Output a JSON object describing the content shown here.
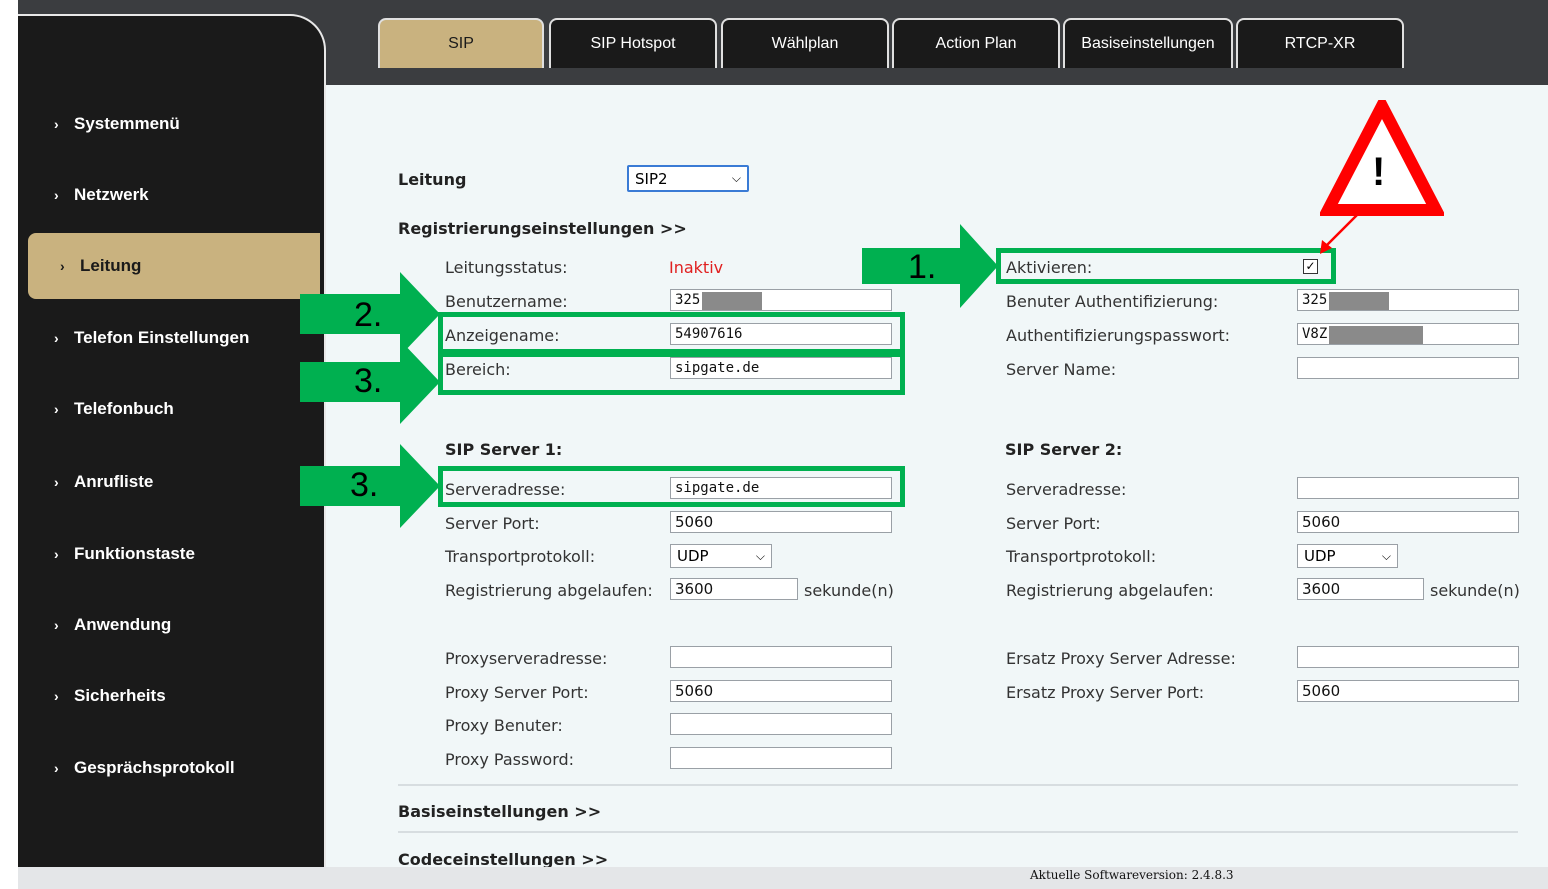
{
  "tabs": [
    "SIP",
    "SIP Hotspot",
    "Wählplan",
    "Action Plan",
    "Basiseinstellungen",
    "RTCP-XR"
  ],
  "sidebar": {
    "items": [
      "Systemmenü",
      "Netzwerk",
      "Leitung",
      "Telefon Einstellungen",
      "Telefonbuch",
      "Anrufliste",
      "Funktionstaste",
      "Anwendung",
      "Sicherheits",
      "Gesprächsprotokoll"
    ],
    "active": "Leitung"
  },
  "line": {
    "label": "Leitung",
    "value": "SIP2"
  },
  "registration": {
    "header": "Registrierungseinstellungen >>",
    "status_label": "Leitungsstatus:",
    "status_value": "Inaktiv",
    "username_label": "Benutzername:",
    "username_value": "325",
    "display_label": "Anzeigename:",
    "display_value": "54907616",
    "realm_label": "Bereich:",
    "realm_value": "sipgate.de",
    "activate_label": "Aktivieren:",
    "activate_checked": true,
    "auth_user_label": "Benuter Authentifizierung:",
    "auth_user_value": "325",
    "auth_pass_label": "Authentifizierungspasswort:",
    "auth_pass_value": "V8Z",
    "server_name_label": "Server Name:",
    "server_name_value": ""
  },
  "server1": {
    "title": "SIP Server 1:",
    "address_label": "Serveradresse:",
    "address_value": "sipgate.de",
    "port_label": "Server Port:",
    "port_value": "5060",
    "transport_label": "Transportprotokoll:",
    "transport_value": "UDP",
    "expire_label": "Registrierung abgelaufen:",
    "expire_value": "3600",
    "unit": "sekunde(n)"
  },
  "server2": {
    "title": "SIP Server 2:",
    "address_label": "Serveradresse:",
    "address_value": "",
    "port_label": "Server Port:",
    "port_value": "5060",
    "transport_label": "Transportprotokoll:",
    "transport_value": "UDP",
    "expire_label": "Registrierung abgelaufen:",
    "expire_value": "3600",
    "unit": "sekunde(n)"
  },
  "proxy": {
    "address_label": "Proxyserveradresse:",
    "address_value": "",
    "port_label": "Proxy Server Port:",
    "port_value": "5060",
    "user_label": "Proxy Benuter:",
    "user_value": "",
    "password_label": "Proxy Password:",
    "password_value": "",
    "backup_address_label": "Ersatz Proxy Server Adresse:",
    "backup_address_value": "",
    "backup_port_label": "Ersatz Proxy Server Port:",
    "backup_port_value": "5060"
  },
  "sections": {
    "basic": "Basiseinstellungen >>",
    "codec": "Codeceinstellungen >>"
  },
  "annotations": {
    "step1": "1.",
    "step2": "2.",
    "step3": "3.",
    "warning": "!",
    "highlight_color": "#00b050",
    "warning_color": "#ff0000"
  },
  "footer": {
    "version": "Aktuelle Softwareversion: 2.4.8.3"
  }
}
